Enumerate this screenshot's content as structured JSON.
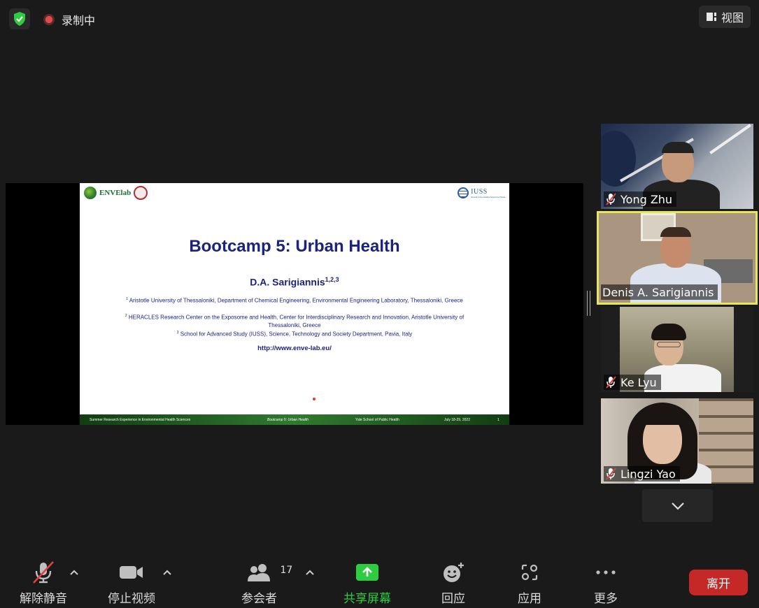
{
  "topbar": {
    "recording_label": "录制中",
    "view_label": "视图"
  },
  "slide": {
    "logo_left": "ENVElab",
    "logo_right": "IUSS",
    "logo_right_sub": "Scuola Universitaria Superiore Pavia",
    "title": "Bootcamp 5: Urban Health",
    "author": "D.A. Sarigiannis",
    "author_sup": "1,2,3",
    "affiliations": [
      {
        "sup": "1",
        "text": "Aristotle University of Thessaloniki, Department of Chemical Engineering, Environmental Engineering Laboratory, Thessaloniki, Greece"
      },
      {
        "sup": "2",
        "text": "HERACLES Research Center on the Exposome and Health, Center for Interdisciplinary Research and Innovation, Aristotle University of Thessaloniki, Greece"
      },
      {
        "sup": "3",
        "text": "School for Advanced Study (IUSS), Science, Technology and Society Department, Pavia, Italy"
      }
    ],
    "url": "http://www.enve-lab.eu/",
    "footer": {
      "program": "Summer Research Experience in Environmental Health Sciences",
      "session": "Bootcamp 5: Urban Health",
      "school": "Yale School of Public Health",
      "dates": "July 18-29, 2022",
      "page": "1"
    }
  },
  "participants": [
    {
      "name": "Yong Zhu",
      "muted": true
    },
    {
      "name": "Denis A. Sarigiannis",
      "muted": false,
      "active_speaker": true
    },
    {
      "name": "Ke Lyu",
      "muted": true
    },
    {
      "name": "Lingzi Yao",
      "muted": true
    }
  ],
  "toolbar": {
    "unmute_label": "解除静音",
    "stop_video_label": "停止视频",
    "participants_label": "参会者",
    "participants_count": "17",
    "share_label": "共享屏幕",
    "reactions_label": "回应",
    "apps_label": "应用",
    "more_label": "更多",
    "leave_label": "离开"
  },
  "colors": {
    "share_green": "#2ecc40",
    "leave_red": "#c62828",
    "active_border": "#e6e65a",
    "mute_red": "#e04040"
  }
}
